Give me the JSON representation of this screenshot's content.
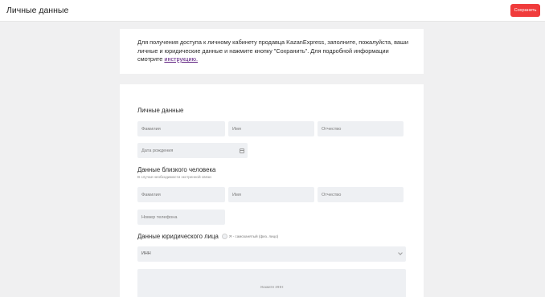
{
  "header": {
    "title": "Личные данные",
    "save_label": "Сохранить"
  },
  "info": {
    "text": "Для получения доступа к личному кабинету продавца KazanExpress, заполните, пожалуйста, ваши личные и юридические данные и нажмите кнопку \"Сохранить\". Для подробной информации смотрите ",
    "link": "инструкцию."
  },
  "personal": {
    "title": "Личные данные",
    "last_name_placeholder": "Фамилия",
    "first_name_placeholder": "Имя",
    "patronymic_placeholder": "Отчество",
    "birth_date_placeholder": "Дата рождения"
  },
  "relative": {
    "title": "Данные близкого человека",
    "hint": "В случае необходимости экстренной связи",
    "last_name_placeholder": "Фамилия",
    "first_name_placeholder": "Имя",
    "patronymic_placeholder": "Отчество",
    "phone_placeholder": "Номер телефона"
  },
  "legal": {
    "title": "Данные юридического лица",
    "self_employed_label": "Я - самозанятый (физ. лицо)",
    "inn_label": "ИНН",
    "inn_hint": "Укажите ИНН"
  }
}
